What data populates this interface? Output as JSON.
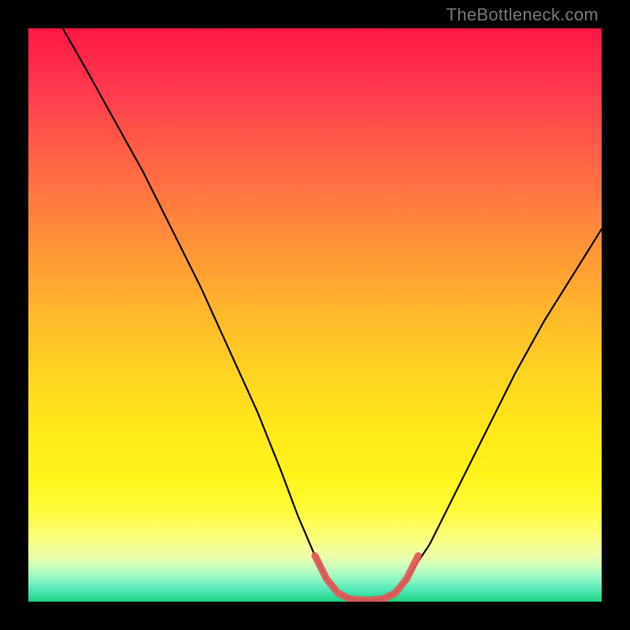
{
  "watermark_text": "TheBottleneck.com",
  "chart_data": {
    "type": "line",
    "title": "",
    "xlabel": "",
    "ylabel": "",
    "xlim": [
      0,
      100
    ],
    "ylim": [
      0,
      100
    ],
    "grid": false,
    "axes_visible": false,
    "series": [
      {
        "name": "bottleneck-curve",
        "color": "#000000",
        "points": [
          {
            "x": 6,
            "y": 100
          },
          {
            "x": 10,
            "y": 93
          },
          {
            "x": 15,
            "y": 84
          },
          {
            "x": 20,
            "y": 75
          },
          {
            "x": 25,
            "y": 65
          },
          {
            "x": 30,
            "y": 55
          },
          {
            "x": 35,
            "y": 44
          },
          {
            "x": 40,
            "y": 33
          },
          {
            "x": 44,
            "y": 23
          },
          {
            "x": 47,
            "y": 15
          },
          {
            "x": 50,
            "y": 8
          },
          {
            "x": 52,
            "y": 4
          },
          {
            "x": 54,
            "y": 1.5
          },
          {
            "x": 56,
            "y": 0.5
          },
          {
            "x": 58,
            "y": 0.3
          },
          {
            "x": 60,
            "y": 0.3
          },
          {
            "x": 62,
            "y": 0.5
          },
          {
            "x": 64,
            "y": 1.5
          },
          {
            "x": 66,
            "y": 4
          },
          {
            "x": 70,
            "y": 10
          },
          {
            "x": 75,
            "y": 20
          },
          {
            "x": 80,
            "y": 30
          },
          {
            "x": 85,
            "y": 40
          },
          {
            "x": 90,
            "y": 49
          },
          {
            "x": 95,
            "y": 57
          },
          {
            "x": 100,
            "y": 65
          }
        ]
      },
      {
        "name": "optimal-zone",
        "color": "#e25a5a",
        "points": [
          {
            "x": 50,
            "y": 8
          },
          {
            "x": 52,
            "y": 4
          },
          {
            "x": 54,
            "y": 1.5
          },
          {
            "x": 56,
            "y": 0.5
          },
          {
            "x": 58,
            "y": 0.3
          },
          {
            "x": 60,
            "y": 0.3
          },
          {
            "x": 62,
            "y": 0.5
          },
          {
            "x": 64,
            "y": 1.5
          },
          {
            "x": 66,
            "y": 4
          },
          {
            "x": 68,
            "y": 8
          }
        ]
      }
    ]
  }
}
